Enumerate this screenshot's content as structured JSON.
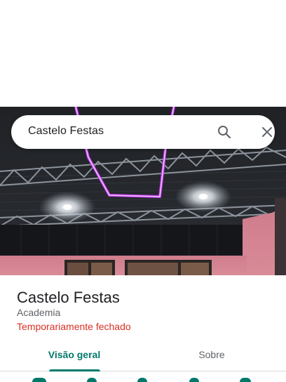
{
  "search": {
    "query": "Castelo Festas"
  },
  "icons": {
    "search": "search-icon",
    "close": "close-icon"
  },
  "place": {
    "name": "Castelo Festas",
    "category": "Academia",
    "status": "Temporariamente fechado"
  },
  "tabs": [
    {
      "label": "Visão geral",
      "selected": true
    },
    {
      "label": "Sobre",
      "selected": false
    }
  ],
  "colors": {
    "accent": "#00796b",
    "status_closed": "#d93025",
    "neon": "#c13cf0"
  }
}
